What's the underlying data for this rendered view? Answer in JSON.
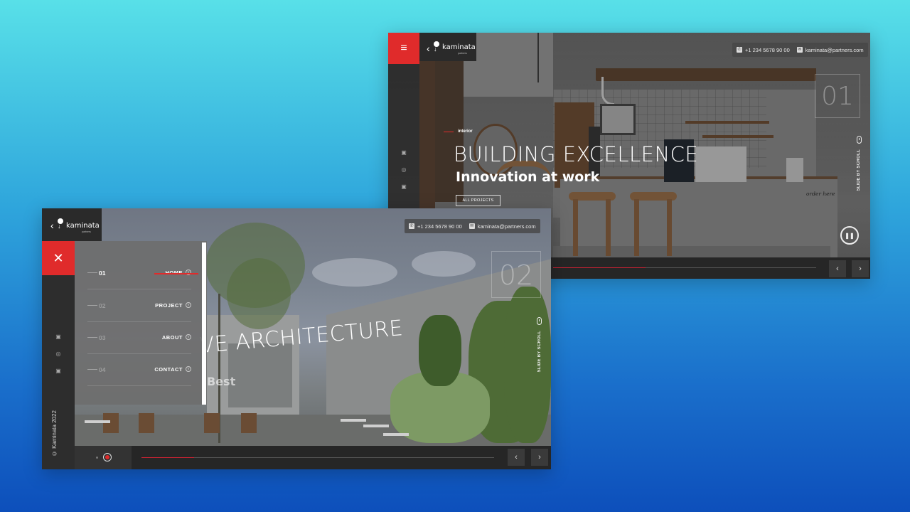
{
  "brand": {
    "name": "kaminata",
    "tagline": "partners"
  },
  "contact": {
    "phone": "+1 234 5678 90 00",
    "email": "kaminata@partners.com"
  },
  "social_icons": [
    "facebook-icon",
    "instagram-icon",
    "twitter-icon"
  ],
  "slide1": {
    "eyebrow": "interior",
    "title": "BUILDING EXCELLENCE",
    "subtitle": "Innovation at work",
    "button_label": "ALL PROJECTS",
    "number": "01",
    "scroll_hint": "SLIDE BY SCROLL",
    "scene_label": "order here",
    "progress": 0.35
  },
  "slide2": {
    "title": "VE ARCHITECTURE",
    "subtitle": "Best",
    "number": "02",
    "scroll_hint": "SLIDE BY SCROLL",
    "copyright": "© Kaminata 2022",
    "progress": 0.15
  },
  "nav": {
    "items": [
      {
        "num": "01",
        "label": "HOME",
        "active": true
      },
      {
        "num": "02",
        "label": "PROJECT",
        "active": false
      },
      {
        "num": "03",
        "label": "ABOUT",
        "active": false
      },
      {
        "num": "04",
        "label": "CONTACT",
        "active": false
      }
    ]
  },
  "controls": {
    "prev": "‹",
    "next": "›",
    "menu_icon": "≡",
    "close_icon": "✕",
    "pause_icon": "❚❚"
  },
  "colors": {
    "accent": "#e02b2b",
    "dark_panel": "#2a2a2a",
    "background_top": "#58e0e8",
    "background_bottom": "#0d4fbb"
  }
}
